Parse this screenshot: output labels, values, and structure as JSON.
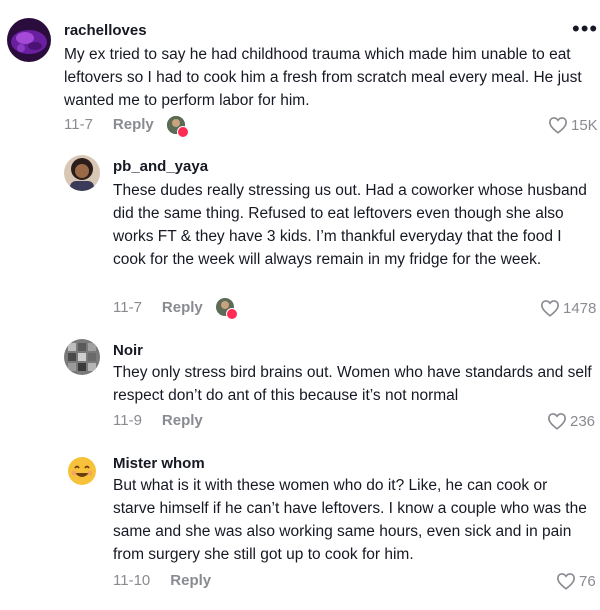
{
  "comments": [
    {
      "username": "rachelloves",
      "text": "My ex tried to say he had childhood trauma which made him unable to eat leftovers so I had to cook him a fresh from scratch meal every meal. He just wanted me to perform labor for him.",
      "date": "11-7",
      "reply_label": "Reply",
      "likes": "15K",
      "avatar_icon": "purple-abstract-avatar"
    },
    {
      "username": "pb_and_yaya",
      "text": "These dudes really stressing us out. Had a coworker whose husband did the same thing. Refused to eat leftovers even though she also works FT & they have 3 kids. I’m thankful everyday that the food I cook for the week will always remain in my fridge for the week.",
      "date": "11-7",
      "reply_label": "Reply",
      "likes": "1478",
      "avatar_icon": "person-photo-avatar"
    },
    {
      "username": "Noir",
      "text": "They only stress bird brains out. Women who have standards and self respect don’t do ant of this because it’s not normal",
      "date": "11-9",
      "reply_label": "Reply",
      "likes": "236",
      "avatar_icon": "grey-pattern-avatar"
    },
    {
      "username": "Mister whom",
      "text": "But what is it with these women who do it? Like, he can cook or starve himself if he can’t have leftovers. I know a couple who was the same and she was also working same hours, even sick and in pain from surgery she still got up to cook for him.",
      "date": "11-10",
      "reply_label": "Reply",
      "likes": "76",
      "avatar_icon": "smiling-emoji-avatar"
    }
  ],
  "more_icon": "more-horizontal-icon",
  "heart_icon": "heart-outline-icon",
  "creator_liked_icon": "creator-liked-badge-icon",
  "colors": {
    "text": "#161823",
    "muted": "#8a8b91",
    "badge": "#fe2c55"
  }
}
